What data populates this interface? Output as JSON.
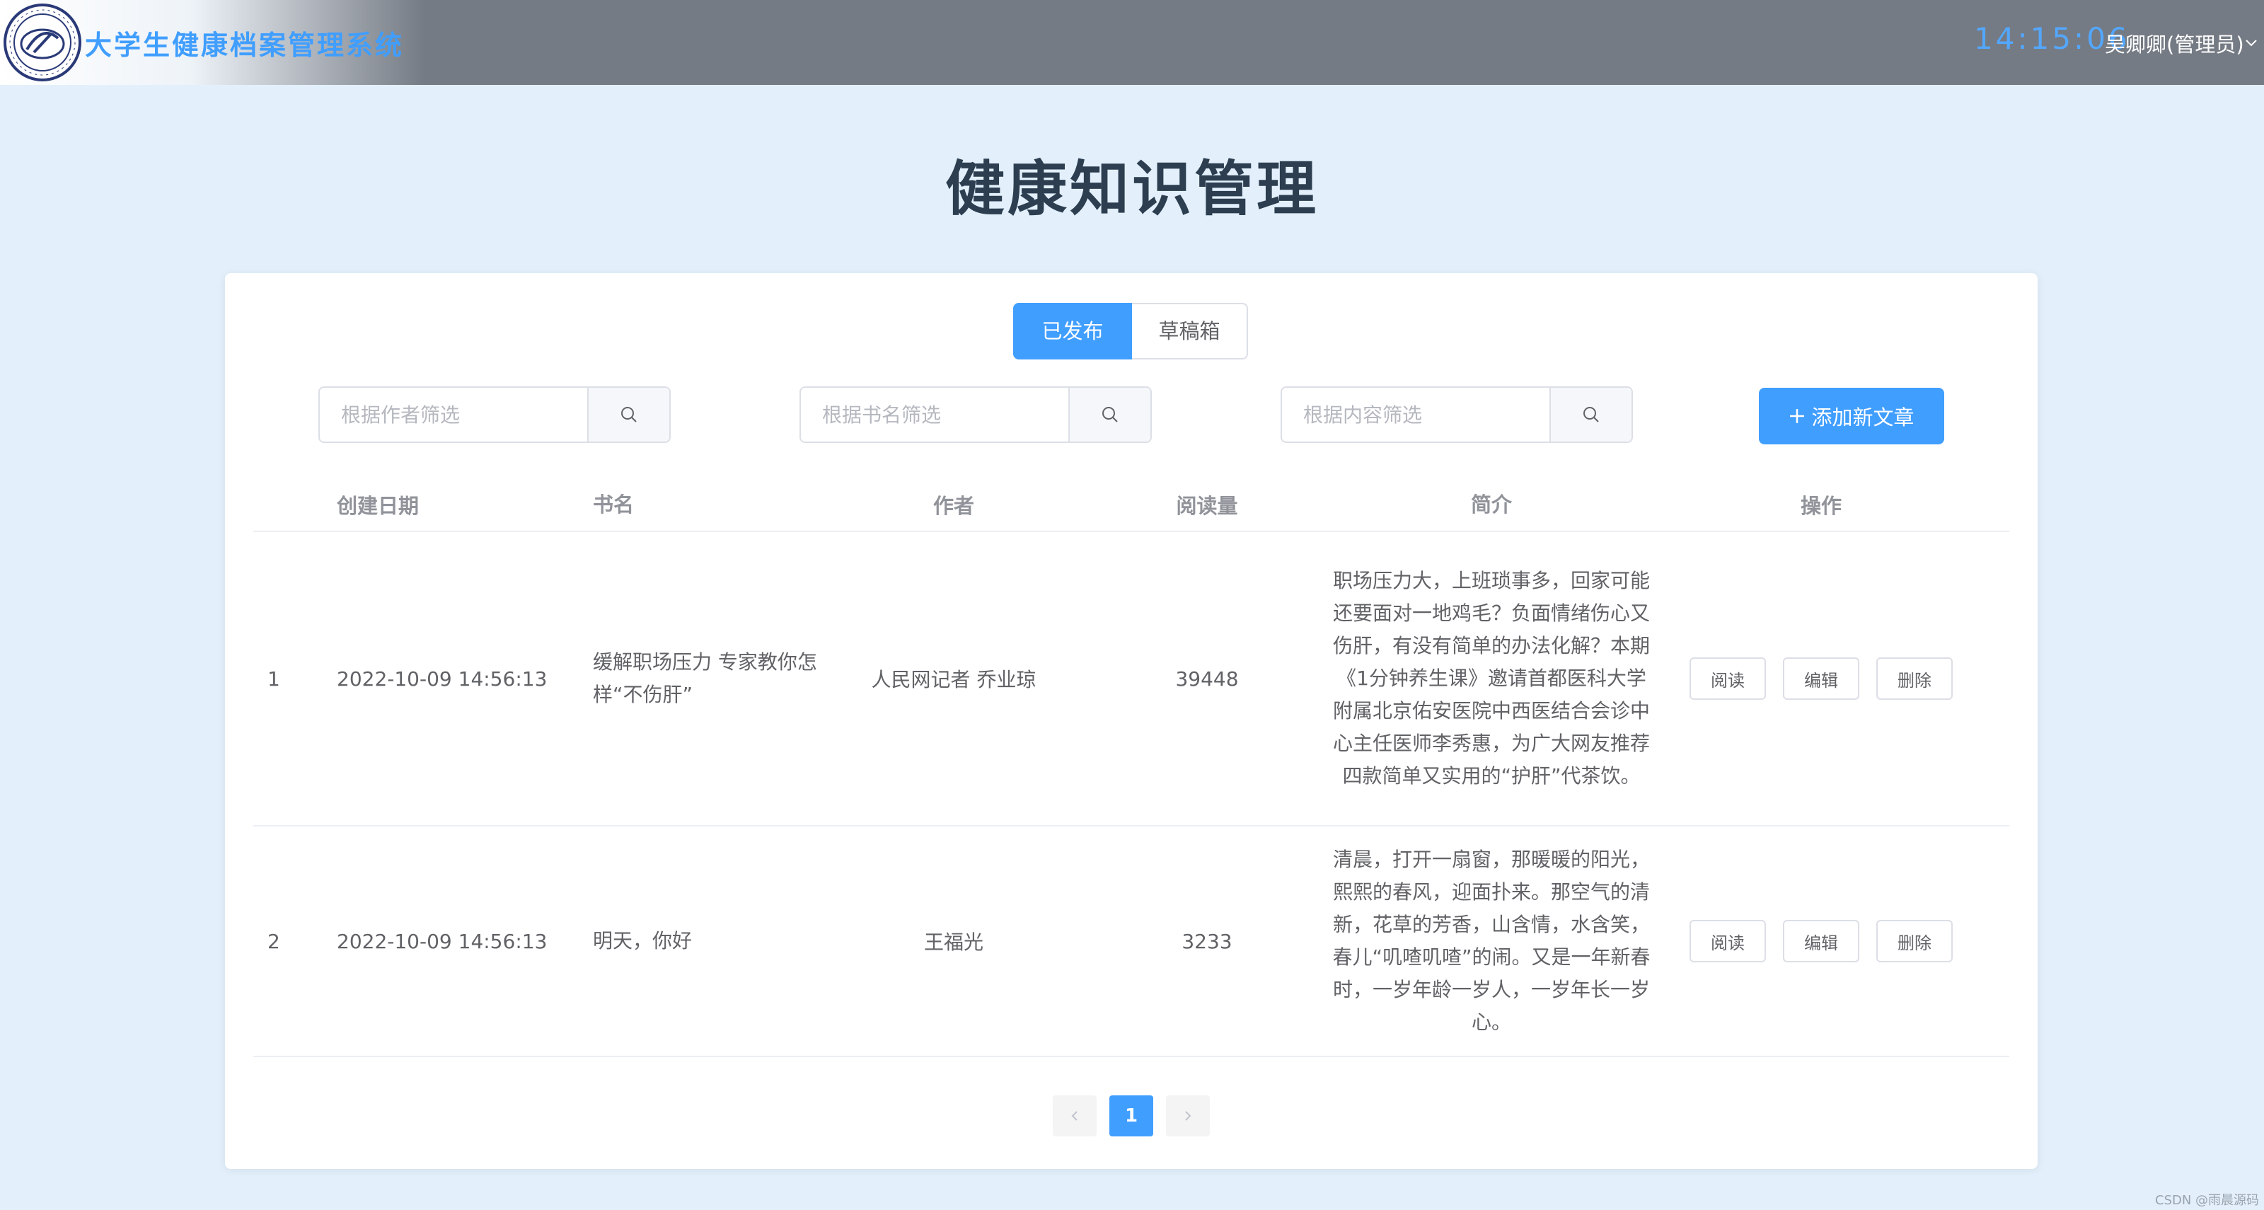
{
  "header": {
    "title": "大学生健康档案管理系统",
    "clock": "14:15:06",
    "user": "吴卿卿(管理员)"
  },
  "page": {
    "title": "健康知识管理"
  },
  "tabs": [
    {
      "label": "已发布",
      "active": true
    },
    {
      "label": "草稿箱",
      "active": false
    }
  ],
  "filters": {
    "author_placeholder": "根据作者筛选",
    "book_placeholder": "根据书名筛选",
    "content_placeholder": "根据内容筛选"
  },
  "add_button": {
    "label": "添加新文章"
  },
  "table": {
    "headers": {
      "date": "创建日期",
      "name": "书名",
      "author": "作者",
      "reads": "阅读量",
      "summary": "简介",
      "ops": "操作"
    },
    "rows": [
      {
        "index": "1",
        "date": "2022-10-09 14:56:13",
        "name": "缓解职场压力 专家教你怎样“不伤肝”",
        "author": "人民网记者 乔业琼",
        "reads": "39448",
        "summary": "职场压力大，上班琐事多，回家可能还要面对一地鸡毛？负面情绪伤心又伤肝，有没有简单的办法化解？本期《1分钟养生课》邀请首都医科大学附属北京佑安医院中西医结合会诊中心主任医师李秀惠，为广大网友推荐四款简单又实用的“护肝”代茶饮。"
      },
      {
        "index": "2",
        "date": "2022-10-09 14:56:13",
        "name": "明天，你好",
        "author": "王福光",
        "reads": "3233",
        "summary": "清晨，打开一扇窗，那暖暖的阳光，熙熙的春风，迎面扑来。那空气的清新，花草的芳香，山含情，水含笑，春儿“叽喳叽喳”的闹。又是一年新春时，一岁年龄一岁人，一岁年长一岁心。"
      }
    ],
    "ops": {
      "read": "阅读",
      "edit": "编辑",
      "delete": "删除"
    }
  },
  "pagination": {
    "current": "1"
  },
  "watermark": "CSDN @雨晨源码",
  "colors": {
    "primary": "#409eff",
    "header_bg": "#757b84",
    "page_bg": "#e3f0fc"
  }
}
